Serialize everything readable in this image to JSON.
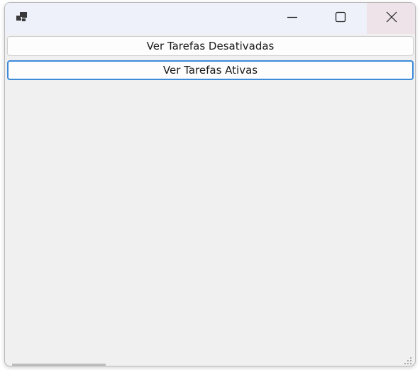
{
  "window": {
    "title_icon": "app-window-icon",
    "caption_buttons": {
      "minimize_icon": "minimize-icon",
      "maximize_icon": "maximize-icon",
      "close_icon": "close-icon"
    }
  },
  "main": {
    "buttons": [
      {
        "label": "Ver Tarefas Desativadas"
      },
      {
        "label": "Ver Tarefas Ativas",
        "focused": true
      }
    ]
  },
  "colors": {
    "titlebar_bg": "#eef1f9",
    "client_bg": "#f0f0f0",
    "focus_border": "#3c8ad8",
    "close_hover_bg": "#ede3e8"
  }
}
